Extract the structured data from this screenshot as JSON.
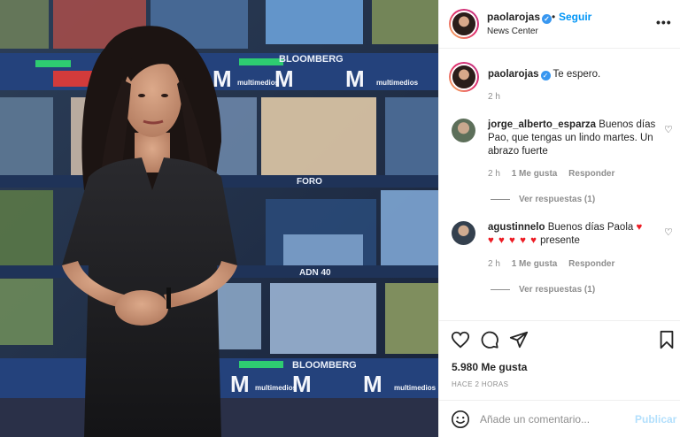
{
  "post": {
    "username": "paolarojas",
    "follow_label": "Seguir",
    "separator": "•",
    "location": "News Center",
    "more_label": "•••"
  },
  "caption": {
    "username": "paolarojas",
    "text": "Te espero.",
    "time": "2 h"
  },
  "comments": [
    {
      "username": "jorge_alberto_esparza",
      "text": "Buenos días Pao, que tengas un lindo martes. Un abrazo fuerte",
      "time": "2 h",
      "likes": "1 Me gusta",
      "reply_label": "Responder",
      "view_replies": "Ver respuestas (1)"
    },
    {
      "username": "agustinnelo",
      "text_before": "Buenos días Paola",
      "hearts": "♥ ♥ ♥ ♥ ♥",
      "text_after": "presente",
      "time": "2 h",
      "likes": "1 Me gusta",
      "reply_label": "Responder",
      "view_replies": "Ver respuestas (1)"
    }
  ],
  "likes_count": "5.980 Me gusta",
  "posted_ago": "HACE 2 HORAS",
  "comment_box": {
    "placeholder": "Añade un comentario...",
    "publish_label": "Publicar"
  },
  "photo": {
    "wall_labels": [
      "BLOOMBERG",
      "FORO",
      "ADN 40",
      "BLOOMBERG"
    ],
    "brand_letter": "M",
    "brand_text": "multimedios"
  },
  "colors": {
    "accent": "#0095f6",
    "verified": "#3897f0",
    "heart": "#ed1c24",
    "publish_disabled": "#b2dffc"
  },
  "icons": [
    "verified-icon",
    "more-options-icon",
    "like-heart-icon",
    "comment-icon",
    "share-icon",
    "save-icon",
    "emoji-icon"
  ]
}
